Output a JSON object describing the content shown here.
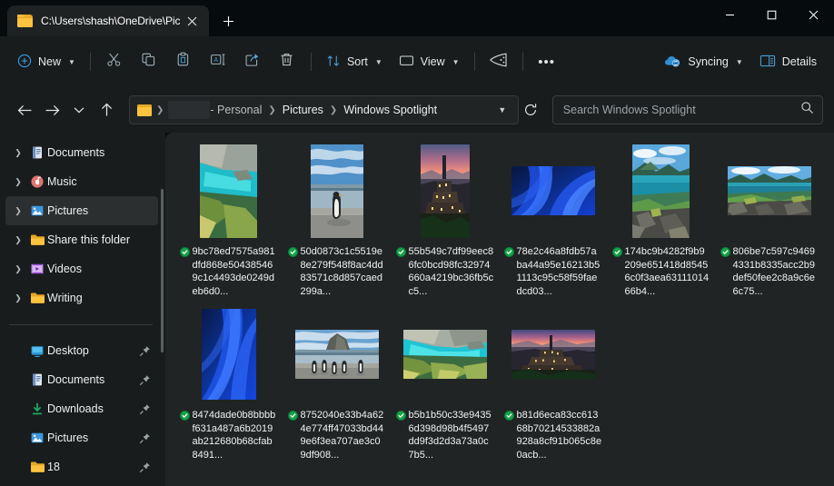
{
  "window": {
    "tab_title": "C:\\Users\\shash\\OneDrive\\Pictu",
    "tab_icon": "folder-icon",
    "close_tab_icon": "close-icon",
    "new_tab_icon": "plus-icon",
    "minimize_icon": "minimize-icon",
    "maximize_icon": "maximize-icon",
    "close_icon": "close-icon"
  },
  "toolbar": {
    "new_label": "New",
    "new_icon": "plus-circle-icon",
    "cut_icon": "scissors-icon",
    "copy_icon": "copy-icon",
    "paste_icon": "clipboard-icon",
    "rename_icon": "rename-icon",
    "share_icon": "share-icon",
    "delete_icon": "trash-icon",
    "sort_label": "Sort",
    "sort_icon": "sort-arrows-icon",
    "view_label": "View",
    "view_icon": "monitor-icon",
    "filter_icon": "filter-icon",
    "more_label": "•••",
    "sync_label": "Syncing",
    "sync_icon": "onedrive-cloud-icon",
    "details_label": "Details",
    "details_icon": "details-pane-icon"
  },
  "address": {
    "back_icon": "arrow-left-icon",
    "forward_icon": "arrow-right-icon",
    "recent_icon": "chevron-down-icon",
    "up_icon": "arrow-up-icon",
    "folder_icon": "folder-icon",
    "redacted": "",
    "account_suffix": "- Personal",
    "crumbs": [
      "Pictures",
      "Windows Spotlight"
    ],
    "dropdown_icon": "chevron-down-icon",
    "refresh_icon": "refresh-icon"
  },
  "search": {
    "placeholder": "Search Windows Spotlight",
    "value": "",
    "icon": "search-icon"
  },
  "sidebar": {
    "tree": [
      {
        "label": "Documents",
        "icon": "documents-icon",
        "expandable": true,
        "selected": false
      },
      {
        "label": "Music",
        "icon": "music-icon",
        "expandable": true,
        "selected": false
      },
      {
        "label": "Pictures",
        "icon": "pictures-icon",
        "expandable": true,
        "selected": true
      },
      {
        "label": "Share this folder",
        "icon": "folder-icon",
        "expandable": true,
        "selected": false
      },
      {
        "label": "Videos",
        "icon": "videos-icon",
        "expandable": true,
        "selected": false
      },
      {
        "label": "Writing",
        "icon": "folder-icon",
        "expandable": true,
        "selected": false
      }
    ],
    "pinned": [
      {
        "label": "Desktop",
        "icon": "desktop-icon",
        "pin": "pin-icon"
      },
      {
        "label": "Documents",
        "icon": "documents-icon",
        "pin": "pin-icon"
      },
      {
        "label": "Downloads",
        "icon": "downloads-icon",
        "pin": "pin-icon"
      },
      {
        "label": "Pictures",
        "icon": "pictures-icon",
        "pin": "pin-icon"
      },
      {
        "label": "18",
        "icon": "folder-icon",
        "pin": "pin-icon"
      }
    ]
  },
  "files": [
    {
      "name": "9bc78ed7575a981dfd868e504385469c1c4493de0249deb6d0...",
      "orient": "portrait",
      "sync": "synced",
      "theme": "lagoon"
    },
    {
      "name": "50d0873c1c5519e8e279f548f8ac4dd83571c8d857caed299a...",
      "orient": "portrait",
      "sync": "synced",
      "theme": "penguin"
    },
    {
      "name": "55b549c7df99eec86fc0bcd98fc32974660a4219bc36fb5cc5...",
      "orient": "portrait",
      "sync": "synced",
      "theme": "hilltown"
    },
    {
      "name": "78e2c46a8fdb57aba44a95e16213b51113c95c58f59faedcd03...",
      "orient": "landscape",
      "sync": "synced",
      "theme": "bluewave"
    },
    {
      "name": "174bc9b4282f9b9209e651418d85456c0f3aea6311101466b4...",
      "orient": "portrait",
      "sync": "synced",
      "theme": "island"
    },
    {
      "name": "806be7c597c94694331b8335acc2b9def50fee2c8a9c6e6c75...",
      "orient": "landscape",
      "sync": "synced",
      "theme": "coast"
    },
    {
      "name": "8474dade0b8bbbbf631a487a6b2019ab212680b68cfab8491...",
      "orient": "portrait",
      "sync": "synced",
      "theme": "bluewave"
    },
    {
      "name": "8752040e33b4a624e774ff47033bd449e6f3ea707ae3c09df908...",
      "orient": "landscape",
      "sync": "synced",
      "theme": "penguinbeach"
    },
    {
      "name": "b5b1b50c33e94356d398d98b4f5497dd9f3d2d3a73a0c7b5...",
      "orient": "landscape",
      "sync": "synced",
      "theme": "lagoonwide"
    },
    {
      "name": "b81d6eca83cc61368b70214533882a928a8cf91b065c8e0acb...",
      "orient": "landscape",
      "sync": "synced",
      "theme": "hilltownwide"
    }
  ],
  "colors": {
    "accent": "#2f9bd8",
    "sync_green": "#17a34a",
    "folder_yellow": "#fcc340",
    "titlebar_bg": "#060c0e",
    "chrome_bg": "#181c1d",
    "content_bg": "#202425"
  }
}
